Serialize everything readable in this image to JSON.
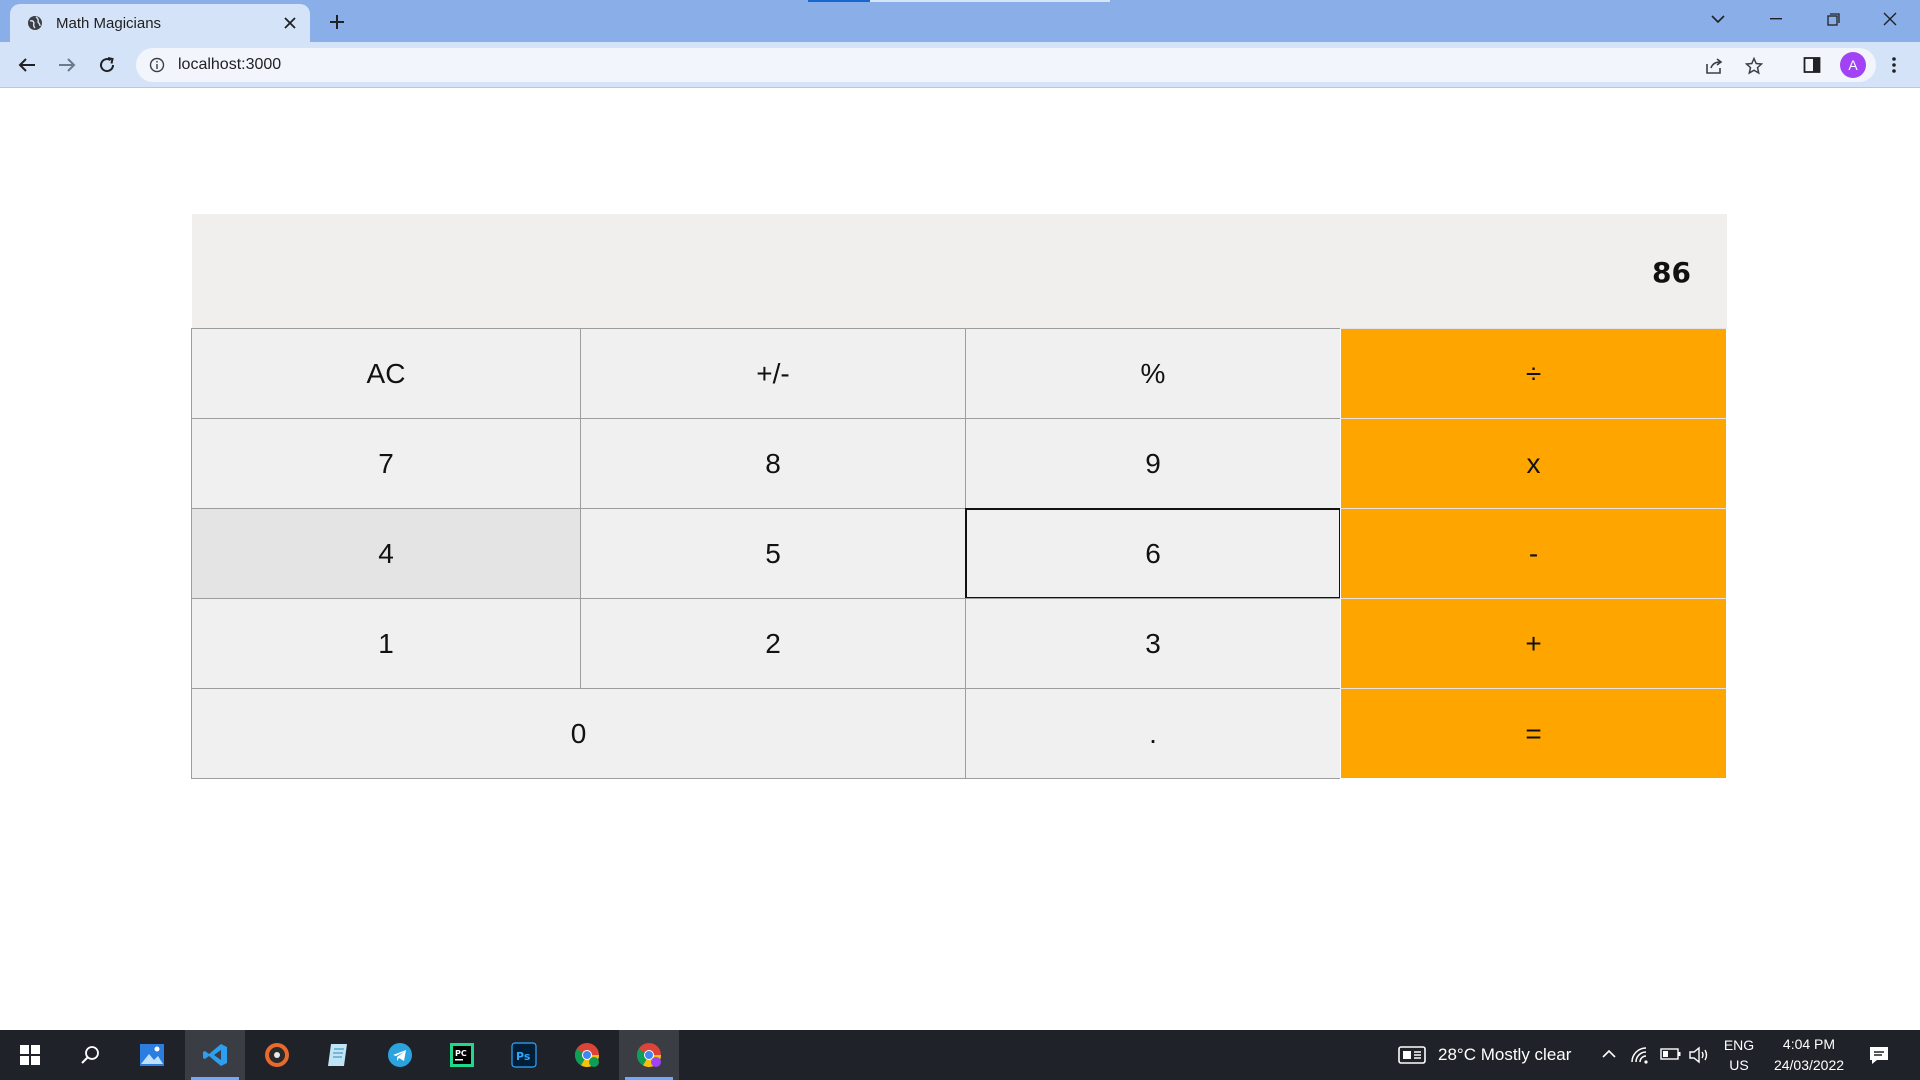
{
  "browser": {
    "tab_title": "Math Magicians",
    "url": "localhost:3000",
    "profile_initial": "A"
  },
  "calculator": {
    "display": "86",
    "rows": [
      [
        {
          "label": "AC",
          "type": "func"
        },
        {
          "label": "+/-",
          "type": "func"
        },
        {
          "label": "%",
          "type": "func"
        },
        {
          "label": "÷",
          "type": "operator"
        }
      ],
      [
        {
          "label": "7",
          "type": "digit"
        },
        {
          "label": "8",
          "type": "digit"
        },
        {
          "label": "9",
          "type": "digit"
        },
        {
          "label": "x",
          "type": "operator"
        }
      ],
      [
        {
          "label": "4",
          "type": "digit"
        },
        {
          "label": "5",
          "type": "digit"
        },
        {
          "label": "6",
          "type": "digit"
        },
        {
          "label": "-",
          "type": "operator"
        }
      ],
      [
        {
          "label": "1",
          "type": "digit"
        },
        {
          "label": "2",
          "type": "digit"
        },
        {
          "label": "3",
          "type": "digit"
        },
        {
          "label": "+",
          "type": "operator"
        }
      ],
      [
        {
          "label": "0",
          "type": "digit"
        },
        {
          "label": ".",
          "type": "digit"
        },
        {
          "label": "=",
          "type": "operator"
        }
      ]
    ],
    "colors": {
      "operator": "#ffa500",
      "key": "#f0f0f0",
      "display": "#f0efed"
    }
  },
  "taskbar": {
    "weather": "28°C  Mostly clear",
    "lang_top": "ENG",
    "lang_bottom": "US",
    "time": "4:04 PM",
    "date": "24/03/2022",
    "apps": [
      "start-icon",
      "search-icon",
      "photos-icon",
      "vscode-icon",
      "media-player-icon",
      "notepad-icon",
      "telegram-icon",
      "pycharm-icon",
      "photoshop-icon",
      "chrome-icon",
      "chrome-profile-icon"
    ]
  }
}
